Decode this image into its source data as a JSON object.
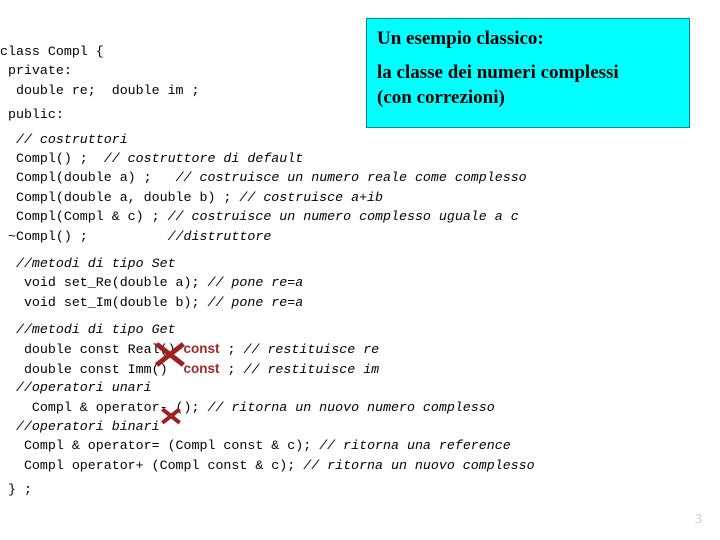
{
  "slide": {
    "page_number": "3",
    "background_color": "#ffffff"
  },
  "title_box": {
    "background_color": "#00ffff",
    "border_color": "#008f8f",
    "text_color": "#000000",
    "lines": [
      "Un esempio classico:",
      "la classe dei numeri complessi",
      "(con correzioni)"
    ]
  },
  "annotations": {
    "strike_color": "#a02020",
    "red_keyword_color": "#9e2a2a",
    "marks": [
      {
        "name": "x-over-const",
        "target": "const"
      },
      {
        "name": "x-over-ampersand",
        "target": "&"
      }
    ]
  },
  "code": {
    "language": "cpp",
    "lines": [
      {
        "id": "l01",
        "text": "class Compl {"
      },
      {
        "id": "l02",
        "text": " private:"
      },
      {
        "id": "l03",
        "text": "  double re;  double im ;"
      },
      {
        "id": "l04",
        "text": " public:"
      },
      {
        "id": "l05",
        "text": "  // costruttori"
      },
      {
        "id": "l06",
        "code": "  Compl() ;  ",
        "comment": "// costruttore di default"
      },
      {
        "id": "l07",
        "code": "  Compl(double a) ;   ",
        "comment": "// costruisce un numero reale come complesso"
      },
      {
        "id": "l08",
        "code": "  Compl(double a, double b) ; ",
        "comment": "// costruisce a+ib"
      },
      {
        "id": "l09",
        "code": "  Compl(Compl & c) ; ",
        "comment": "// costruisce un numero complesso uguale a c"
      },
      {
        "id": "l10",
        "code": " ~Compl() ;          ",
        "comment": "//distruttore"
      },
      {
        "id": "l11",
        "text": "  //metodi di tipo Set"
      },
      {
        "id": "l12",
        "code": "   void set_Re(double a); ",
        "comment": "// pone re=a"
      },
      {
        "id": "l13",
        "code": "   void set_Im(double b); ",
        "comment": "// pone re=a"
      },
      {
        "id": "l14",
        "text": "  //metodi di tipo Get"
      },
      {
        "id": "l15",
        "code_a": "   double const Real() ",
        "keyword": "const",
        "code_b": " ; ",
        "comment": "// restituisce re"
      },
      {
        "id": "l16",
        "code_a": "   double const Imm()  ",
        "keyword": "const",
        "code_b": " ; ",
        "comment": "// restituisce im"
      },
      {
        "id": "l17",
        "text": "  //operatori unari"
      },
      {
        "id": "l18",
        "code": "    Compl & operator- (); ",
        "comment": "// ritorna un nuovo numero complesso"
      },
      {
        "id": "l19",
        "text": "  //operatori binari"
      },
      {
        "id": "l20",
        "code": "   Compl & operator= (Compl const & c); ",
        "comment": "// ritorna una reference"
      },
      {
        "id": "l21",
        "code": "   Compl operator+ (Compl const & c); ",
        "comment": "// ritorna un nuovo complesso"
      },
      {
        "id": "l22",
        "text": " } ;"
      }
    ]
  }
}
